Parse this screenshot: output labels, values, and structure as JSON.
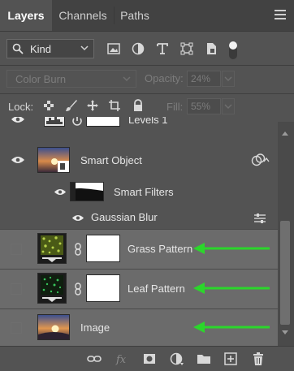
{
  "tabs": [
    {
      "label": "Layers",
      "active": true
    },
    {
      "label": "Channels",
      "active": false
    },
    {
      "label": "Paths",
      "active": false
    }
  ],
  "filter": {
    "kind_label": "Kind",
    "icons": [
      "image-filter-icon",
      "adjustment-filter-icon",
      "type-filter-icon",
      "shape-filter-icon",
      "smart-object-filter-icon"
    ]
  },
  "blend": {
    "mode": "Color Burn",
    "opacity_label": "Opacity:",
    "opacity_value": "24%"
  },
  "lock": {
    "label": "Lock:",
    "fill_label": "Fill:",
    "fill_value": "55%"
  },
  "layers": [
    {
      "name": "Levels 1",
      "type": "adjustment",
      "visible": true
    },
    {
      "name": "Smart Object",
      "type": "smart-object",
      "visible": true
    },
    {
      "name": "Smart Filters",
      "type": "smart-filters",
      "visible": true
    },
    {
      "name": "Gaussian Blur",
      "type": "filter",
      "visible": true
    },
    {
      "name": "Grass Pattern",
      "type": "masked-layer",
      "visible": false,
      "selected": true
    },
    {
      "name": "Leaf Pattern",
      "type": "masked-layer",
      "visible": false,
      "selected": true
    },
    {
      "name": "Image",
      "type": "image-layer",
      "visible": false,
      "selected": true
    }
  ],
  "colors": {
    "annotation_arrow": "#2bd62b",
    "panel_bg": "#535353",
    "selected_row": "#6b6b6b"
  }
}
